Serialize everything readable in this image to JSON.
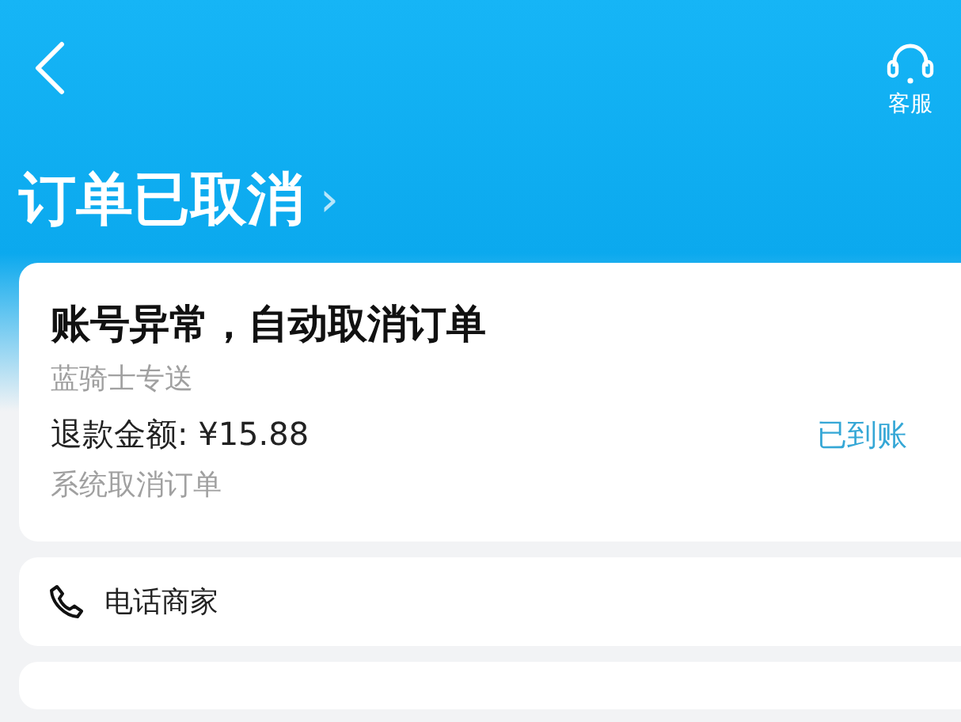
{
  "nav": {
    "service_label": "客服"
  },
  "status": {
    "title": "订单已取消",
    "chevron": "›"
  },
  "order_card": {
    "reason": "账号异常，自动取消订单",
    "delivery": "蓝骑士专送",
    "refund": "退款金额: ¥15.88",
    "refund_status": "已到账",
    "note": "系统取消订单"
  },
  "contact_card": {
    "label": "电话商家"
  }
}
